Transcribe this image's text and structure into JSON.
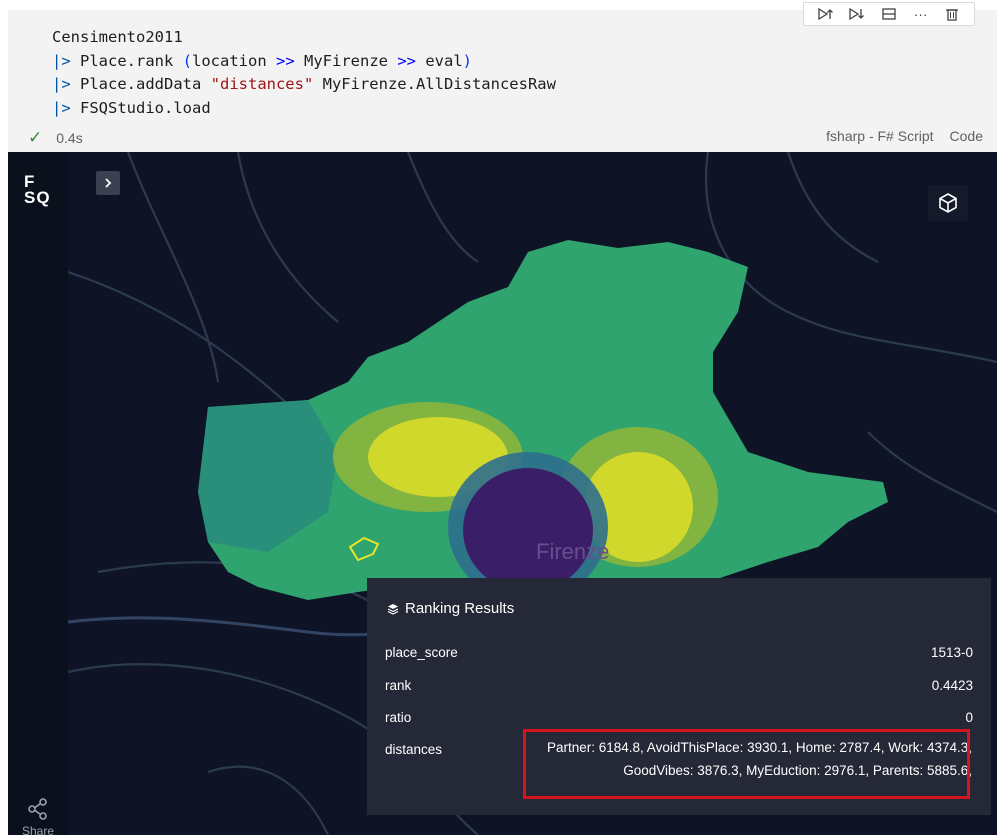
{
  "cell": {
    "code_lines": [
      {
        "parts": [
          {
            "t": "Censimento2011",
            "c": ""
          }
        ]
      },
      {
        "parts": [
          {
            "t": "|>",
            "c": "pipe"
          },
          {
            "t": " Place.rank ",
            "c": ""
          },
          {
            "t": "(",
            "c": "paren"
          },
          {
            "t": "location ",
            "c": ""
          },
          {
            "t": ">>",
            "c": "op"
          },
          {
            "t": " MyFirenze ",
            "c": ""
          },
          {
            "t": ">>",
            "c": "op"
          },
          {
            "t": " eval",
            "c": ""
          },
          {
            "t": ")",
            "c": "paren"
          }
        ]
      },
      {
        "parts": [
          {
            "t": "|>",
            "c": "pipe"
          },
          {
            "t": " Place.addData ",
            "c": ""
          },
          {
            "t": "\"distances\"",
            "c": "str"
          },
          {
            "t": " MyFirenze.AllDistancesRaw",
            "c": ""
          }
        ]
      },
      {
        "parts": [
          {
            "t": "|>",
            "c": "pipe"
          },
          {
            "t": " FSQStudio.load",
            "c": ""
          }
        ]
      }
    ],
    "exec_time": "0.4s",
    "kernel": "fsharp - F# Script",
    "mode": "Code"
  },
  "toolbar": {
    "icons": [
      "run-above-icon",
      "run-below-icon",
      "split-cell-icon",
      "more-icon",
      "delete-icon"
    ],
    "more_label": "···"
  },
  "map": {
    "logo_line1": "F",
    "logo_line2": "SQ",
    "city_label": "Firenze",
    "share_label": "Share",
    "colors": {
      "green": "#2fa46e",
      "teal": "#26867f",
      "yellow": "#d8dc2a",
      "olive": "#8fb73a",
      "purple": "#3a1e68",
      "background": "#0e1426"
    }
  },
  "panel": {
    "title": "Ranking Results",
    "rows": [
      {
        "label": "place_score",
        "value": "1513-0"
      },
      {
        "label": "rank",
        "value": "0.4423"
      },
      {
        "label": "ratio",
        "value": "0"
      }
    ],
    "distances_label": "distances",
    "distances_line1": "Partner: 6184.8, AvoidThisPlace: 3930.1, Home: 2787.4, Work: 4374.3,",
    "distances_line2": "GoodVibes: 3876.3, MyEduction: 2976.1, Parents: 5885.6,"
  }
}
